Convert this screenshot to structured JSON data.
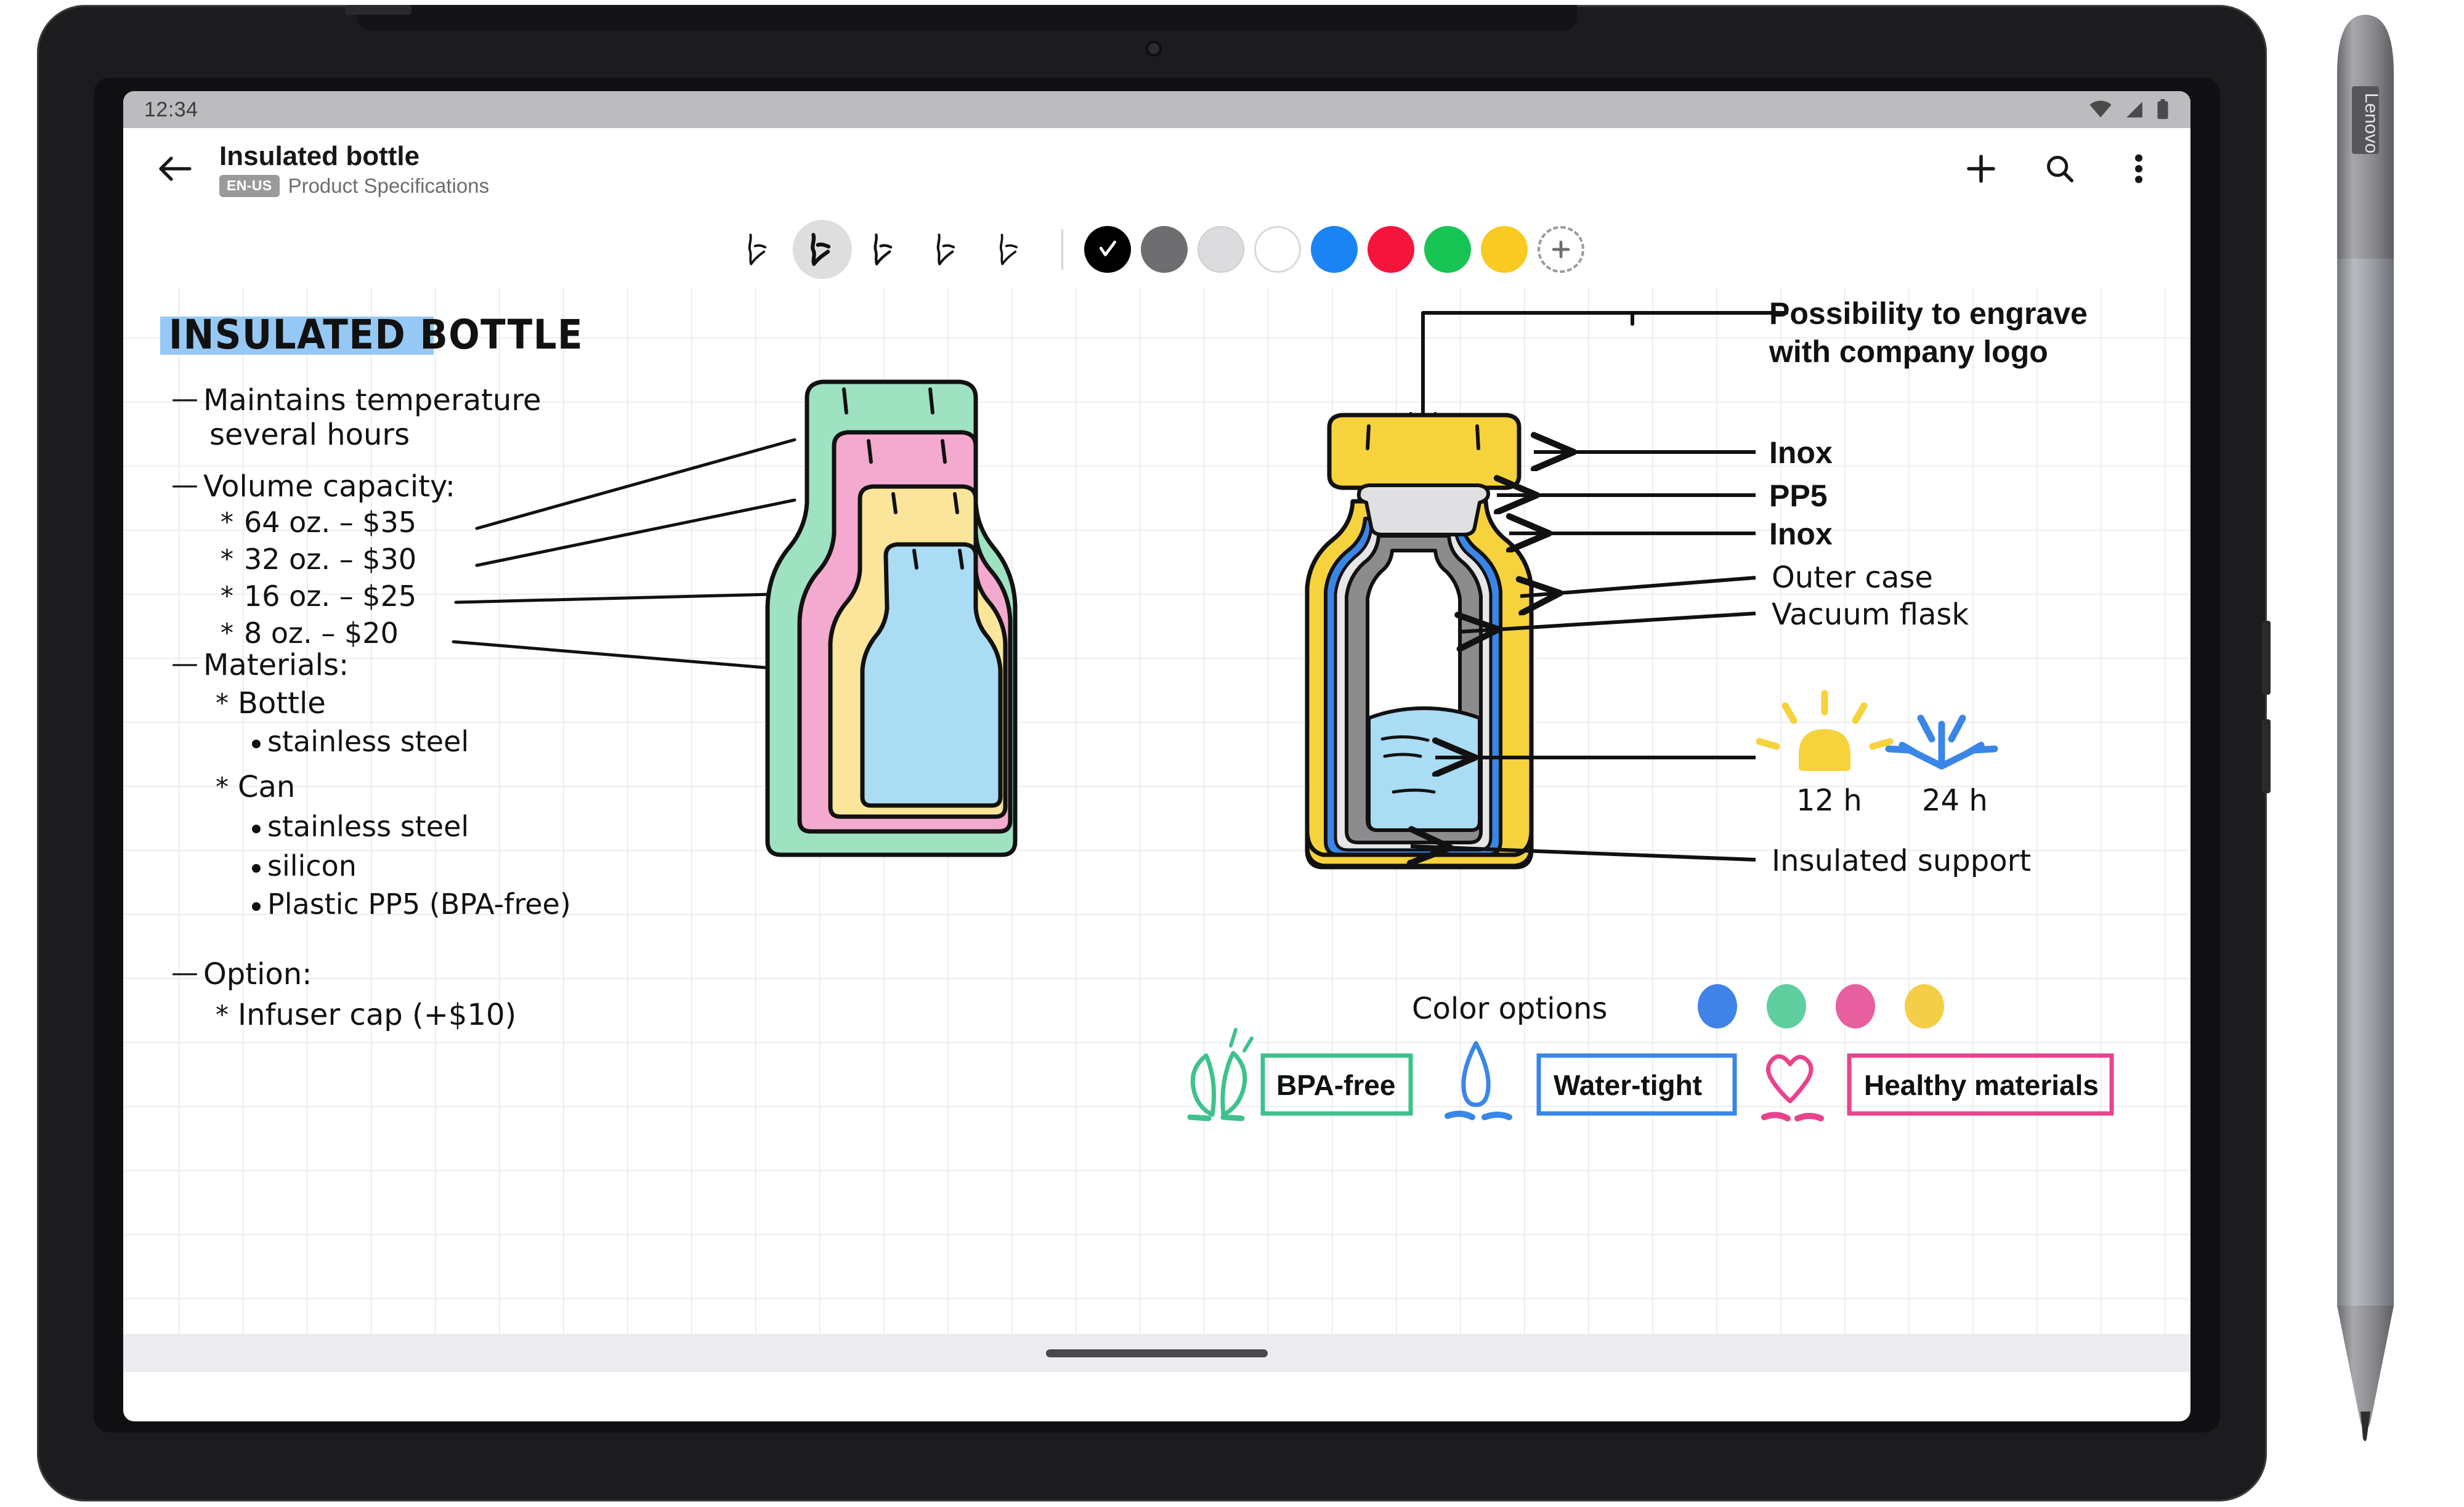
{
  "device": {
    "brand": "Lenovo",
    "stylus_label": "Lenovo"
  },
  "status_bar": {
    "time": "12:34",
    "icons": [
      "wifi-icon",
      "cell-signal-icon",
      "battery-icon"
    ]
  },
  "app_bar": {
    "back_icon": "arrow-left-icon",
    "title": "Insulated bottle",
    "language_badge": "EN-US",
    "subtitle": "Product Specifications",
    "actions": [
      {
        "name": "add-button",
        "icon": "plus-icon"
      },
      {
        "name": "search-button",
        "icon": "search-icon"
      },
      {
        "name": "overflow-menu-button",
        "icon": "more-vertical-icon"
      }
    ]
  },
  "pen_toolbar": {
    "pens": [
      {
        "name": "pen-tool-1",
        "selected": false
      },
      {
        "name": "pen-tool-2",
        "selected": true
      },
      {
        "name": "pen-tool-3",
        "selected": false
      },
      {
        "name": "pen-tool-4",
        "selected": false
      },
      {
        "name": "pen-tool-5",
        "selected": false
      }
    ],
    "colors": [
      {
        "name": "color-black",
        "hex": "#000000",
        "selected": true
      },
      {
        "name": "color-dark-gray",
        "hex": "#6e6e70",
        "selected": false
      },
      {
        "name": "color-light-gray",
        "hex": "#dcdcde",
        "selected": false
      },
      {
        "name": "color-white",
        "hex": "#ffffff",
        "selected": false
      },
      {
        "name": "color-blue",
        "hex": "#1a84f5",
        "selected": false
      },
      {
        "name": "color-red",
        "hex": "#f5143c",
        "selected": false
      },
      {
        "name": "color-green",
        "hex": "#18c454",
        "selected": false
      },
      {
        "name": "color-yellow",
        "hex": "#f8ca22",
        "selected": false
      }
    ],
    "add_color_label": "+"
  },
  "note": {
    "heading": "INSULATED BOTTLE",
    "heading_highlight_hex": "#96c8f5",
    "bullets": [
      {
        "dash": "—",
        "lines": [
          "Maintains temperature",
          "several hours"
        ]
      }
    ],
    "volume": {
      "dash": "—",
      "label": "Volume capacity:",
      "items": [
        {
          "star": "*",
          "text": "64 oz. – $35"
        },
        {
          "star": "*",
          "text": "32 oz. – $30"
        },
        {
          "star": "*",
          "text": "16 oz. – $25"
        },
        {
          "star": "*",
          "text": "8 oz. – $20"
        }
      ]
    },
    "materials": {
      "dash": "—",
      "label": "Materials:",
      "groups": [
        {
          "star": "*",
          "name": "Bottle",
          "items": [
            "stainless steel"
          ]
        },
        {
          "star": "*",
          "name": "Can",
          "items": [
            "stainless steel",
            "silicon",
            "Plastic PP5 (BPA-free)"
          ]
        }
      ]
    },
    "option": {
      "dash": "—",
      "label": "Option:",
      "items": [
        {
          "star": "*",
          "text": "Infuser cap (+$10)"
        }
      ]
    }
  },
  "capacity_diagram": {
    "name": "nested-bottles-diagram",
    "layers": [
      {
        "label": "64 oz.",
        "hex": "#9ee2c2"
      },
      {
        "label": "32 oz.",
        "hex": "#f4aace"
      },
      {
        "label": "16 oz.",
        "hex": "#fae59a"
      },
      {
        "label": "8 oz.",
        "hex": "#aadcf4"
      }
    ]
  },
  "cutaway_diagram": {
    "name": "bottle-cutaway-diagram",
    "cap_hex": "#f6d23d",
    "outer_case_hex": "#f6d23d",
    "vacuum_flask_hex": "#8c8c8e",
    "blue_layer_hex": "#3a86e8",
    "gasket_hex": "#e0e0e2",
    "liquid_hex": "#aadcf4"
  },
  "callouts": {
    "printed": [
      {
        "name": "callout-engrave",
        "text": "Possibility to engrave\nwith company logo",
        "line1": "Possibility to engrave",
        "line2": "with company logo"
      },
      {
        "name": "callout-inox-cap",
        "text": "Inox"
      },
      {
        "name": "callout-pp5",
        "text": "PP5"
      },
      {
        "name": "callout-inox-body",
        "text": "Inox"
      }
    ],
    "handwritten": [
      {
        "name": "callout-outer-case",
        "text": "Outer case"
      },
      {
        "name": "callout-vacuum-flask",
        "text": "Vacuum flask"
      },
      {
        "name": "callout-insulated-support",
        "text": "Insulated support"
      }
    ]
  },
  "thermal": [
    {
      "name": "hot-retention",
      "icon": "sun-icon",
      "value": "12 h",
      "hex": "#f6d23d"
    },
    {
      "name": "cold-retention",
      "icon": "snowflake-icon",
      "value": "24 h",
      "hex": "#3a86e8"
    }
  ],
  "color_options": {
    "label": "Color options",
    "swatches": [
      {
        "name": "bottle-color-blue",
        "hex": "#3f82e8"
      },
      {
        "name": "bottle-color-green",
        "hex": "#5fcfa0"
      },
      {
        "name": "bottle-color-pink",
        "hex": "#e85fa0"
      },
      {
        "name": "bottle-color-yellow",
        "hex": "#f4ce46"
      }
    ]
  },
  "badges": [
    {
      "name": "badge-bpa-free",
      "label": "BPA-free",
      "hex": "#3ec28d",
      "icon": "leaf-icon"
    },
    {
      "name": "badge-water-tight",
      "label": "Water-tight",
      "hex": "#3a86e8",
      "icon": "droplet-icon"
    },
    {
      "name": "badge-healthy-materials",
      "label": "Healthy materials",
      "hex": "#e8448e",
      "icon": "heart-icon"
    }
  ]
}
